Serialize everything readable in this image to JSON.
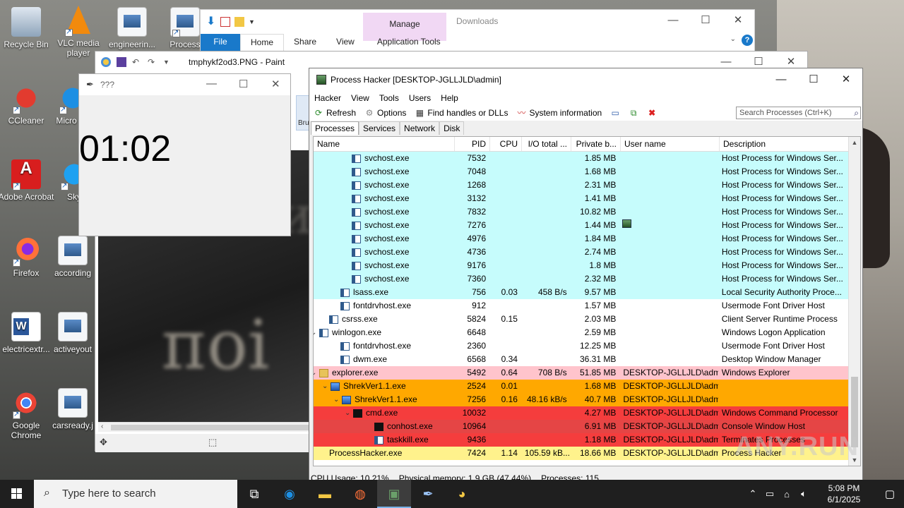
{
  "desktop": {
    "icons": [
      {
        "label": "Recycle Bin"
      },
      {
        "label": "VLC media player"
      },
      {
        "label": "engineerin..."
      },
      {
        "label": "Process"
      },
      {
        "label": "CCleaner"
      },
      {
        "label": "Micro Ed"
      },
      {
        "label": "Adobe Acrobat"
      },
      {
        "label": "Sky"
      },
      {
        "label": "Firefox"
      },
      {
        "label": "according"
      },
      {
        "label": "electricextr..."
      },
      {
        "label": "activeyout"
      },
      {
        "label": "Google Chrome"
      },
      {
        "label": "carsready.j"
      }
    ]
  },
  "explorer": {
    "tabs": [
      "File",
      "Home",
      "Share",
      "View",
      "Application Tools"
    ],
    "manage": "Manage",
    "title": "Downloads"
  },
  "paint": {
    "title": "tmphykf2od3.PNG - Paint",
    "brush_label": "Bru"
  },
  "timer": {
    "title": "???",
    "time": "01:02"
  },
  "process_hacker": {
    "title": "Process Hacker [DESKTOP-JGLLJLD\\admin]",
    "menu": [
      "Hacker",
      "View",
      "Tools",
      "Users",
      "Help"
    ],
    "toolbar": {
      "refresh": "Refresh",
      "options": "Options",
      "find_handles": "Find handles or DLLs",
      "system_info": "System information"
    },
    "search_placeholder": "Search Processes (Ctrl+K)",
    "tabs": [
      "Processes",
      "Services",
      "Network",
      "Disk"
    ],
    "columns": [
      "Name",
      "PID",
      "CPU",
      "I/O total ...",
      "Private b...",
      "User name",
      "Description"
    ],
    "rows": [
      {
        "name": "svchost.exe",
        "pid": "7532",
        "cpu": "",
        "io": "",
        "priv": "1.85 MB",
        "user": "",
        "desc": "Host Process for Windows Ser..."
      },
      {
        "name": "svchost.exe",
        "pid": "7048",
        "cpu": "",
        "io": "",
        "priv": "1.68 MB",
        "user": "",
        "desc": "Host Process for Windows Ser..."
      },
      {
        "name": "svchost.exe",
        "pid": "1268",
        "cpu": "",
        "io": "",
        "priv": "2.31 MB",
        "user": "",
        "desc": "Host Process for Windows Ser..."
      },
      {
        "name": "svchost.exe",
        "pid": "3132",
        "cpu": "",
        "io": "",
        "priv": "1.41 MB",
        "user": "",
        "desc": "Host Process for Windows Ser..."
      },
      {
        "name": "svchost.exe",
        "pid": "7832",
        "cpu": "",
        "io": "",
        "priv": "10.82 MB",
        "user": "",
        "desc": "Host Process for Windows Ser..."
      },
      {
        "name": "svchost.exe",
        "pid": "7276",
        "cpu": "",
        "io": "",
        "priv": "1.44 MB",
        "user": "",
        "desc": "Host Process for Windows Ser..."
      },
      {
        "name": "svchost.exe",
        "pid": "4976",
        "cpu": "",
        "io": "",
        "priv": "1.84 MB",
        "user": "",
        "desc": "Host Process for Windows Ser..."
      },
      {
        "name": "svchost.exe",
        "pid": "4736",
        "cpu": "",
        "io": "",
        "priv": "2.74 MB",
        "user": "",
        "desc": "Host Process for Windows Ser..."
      },
      {
        "name": "svchost.exe",
        "pid": "9176",
        "cpu": "",
        "io": "",
        "priv": "1.8 MB",
        "user": "",
        "desc": "Host Process for Windows Ser..."
      },
      {
        "name": "svchost.exe",
        "pid": "7360",
        "cpu": "",
        "io": "",
        "priv": "2.32 MB",
        "user": "",
        "desc": "Host Process for Windows Ser..."
      },
      {
        "name": "lsass.exe",
        "pid": "756",
        "cpu": "0.03",
        "io": "458 B/s",
        "priv": "9.57 MB",
        "user": "",
        "desc": "Local Security Authority Proce..."
      },
      {
        "name": "fontdrvhost.exe",
        "pid": "912",
        "cpu": "",
        "io": "",
        "priv": "1.57 MB",
        "user": "",
        "desc": "Usermode Font Driver Host"
      },
      {
        "name": "csrss.exe",
        "pid": "5824",
        "cpu": "0.15",
        "io": "",
        "priv": "2.03 MB",
        "user": "",
        "desc": "Client Server Runtime Process"
      },
      {
        "name": "winlogon.exe",
        "pid": "6648",
        "cpu": "",
        "io": "",
        "priv": "2.59 MB",
        "user": "",
        "desc": "Windows Logon Application"
      },
      {
        "name": "fontdrvhost.exe",
        "pid": "2360",
        "cpu": "",
        "io": "",
        "priv": "12.25 MB",
        "user": "",
        "desc": "Usermode Font Driver Host"
      },
      {
        "name": "dwm.exe",
        "pid": "6568",
        "cpu": "0.34",
        "io": "",
        "priv": "36.31 MB",
        "user": "",
        "desc": "Desktop Window Manager"
      },
      {
        "name": "explorer.exe",
        "pid": "5492",
        "cpu": "0.64",
        "io": "708 B/s",
        "priv": "51.85 MB",
        "user": "DESKTOP-JGLLJLD\\admi",
        "desc": "Windows Explorer"
      },
      {
        "name": "ShrekVer1.1.exe",
        "pid": "2524",
        "cpu": "0.01",
        "io": "",
        "priv": "1.68 MB",
        "user": "DESKTOP-JGLLJLD\\admi",
        "desc": ""
      },
      {
        "name": "ShrekVer1.1.exe",
        "pid": "7256",
        "cpu": "0.16",
        "io": "48.16 kB/s",
        "priv": "40.7 MB",
        "user": "DESKTOP-JGLLJLD\\admi",
        "desc": ""
      },
      {
        "name": "cmd.exe",
        "pid": "10032",
        "cpu": "",
        "io": "",
        "priv": "4.27 MB",
        "user": "DESKTOP-JGLLJLD\\admi",
        "desc": "Windows Command Processor"
      },
      {
        "name": "conhost.exe",
        "pid": "10964",
        "cpu": "",
        "io": "",
        "priv": "6.91 MB",
        "user": "DESKTOP-JGLLJLD\\admi",
        "desc": "Console Window Host"
      },
      {
        "name": "taskkill.exe",
        "pid": "9436",
        "cpu": "",
        "io": "",
        "priv": "1.18 MB",
        "user": "DESKTOP-JGLLJLD\\admi",
        "desc": "Terminates Processes"
      },
      {
        "name": "ProcessHacker.exe",
        "pid": "7424",
        "cpu": "1.14",
        "io": "105.59 kB...",
        "priv": "18.66 MB",
        "user": "DESKTOP-JGLLJLD\\admi",
        "desc": "Process Hacker"
      }
    ],
    "status": {
      "cpu": "CPU Usage: 10.21%",
      "memory": "Physical memory: 1.9 GB (47.44%)",
      "processes": "Processes: 115"
    },
    "colors": {
      "service": "#c6fcfc",
      "system": "#ffffff",
      "user": "#ffc4cc",
      "packed": "#ffa800",
      "jobbed": "#f53d3d",
      "suspended": "#e54545",
      "own": "#fff28c"
    }
  },
  "watermark": "ANY.RUN",
  "taskbar": {
    "search_placeholder": "Type here to search",
    "time": "5:08 PM",
    "date": "6/1/2025"
  }
}
